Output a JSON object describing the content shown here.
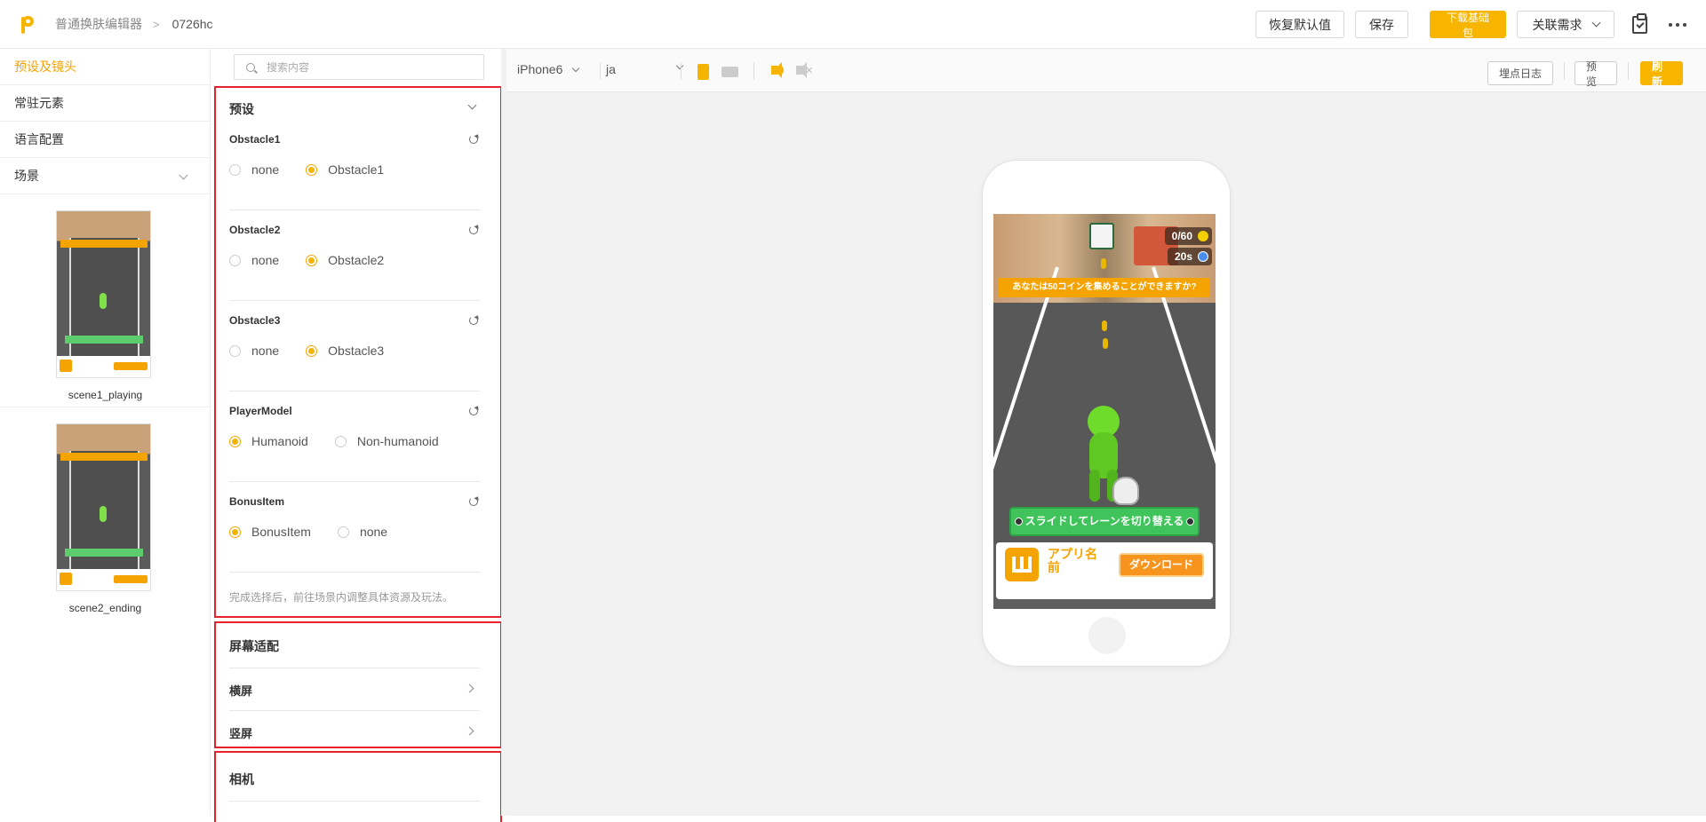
{
  "header": {
    "breadcrumb_root": "普通换肤编辑器",
    "breadcrumb_sep": ">",
    "breadcrumb_current": "0726hc",
    "reset_label": "恢复默认值",
    "save_label": "保存",
    "download_label": "下载基础包",
    "related_label": "关联需求"
  },
  "sidebar": {
    "items": [
      {
        "label": "预设及镜头"
      },
      {
        "label": "常驻元素"
      },
      {
        "label": "语言配置"
      },
      {
        "label": "场景"
      }
    ],
    "scenes": [
      {
        "label": "scene1_playing"
      },
      {
        "label": "scene2_ending"
      }
    ]
  },
  "panel": {
    "search_placeholder": "搜索内容",
    "preset_title": "预设",
    "groups": [
      {
        "title": "Obstacle1",
        "options": [
          "none",
          "Obstacle1"
        ],
        "selected": "Obstacle1"
      },
      {
        "title": "Obstacle2",
        "options": [
          "none",
          "Obstacle2"
        ],
        "selected": "Obstacle2"
      },
      {
        "title": "Obstacle3",
        "options": [
          "none",
          "Obstacle3"
        ],
        "selected": "Obstacle3"
      },
      {
        "title": "PlayerModel",
        "options": [
          "Humanoid",
          "Non-humanoid"
        ],
        "selected": "Humanoid"
      },
      {
        "title": "BonusItem",
        "options": [
          "BonusItem",
          "none"
        ],
        "selected": "BonusItem"
      }
    ],
    "note": "完成选择后，前往场景内调整具体资源及玩法。",
    "screen_title": "屏幕适配",
    "landscape_label": "横屏",
    "portrait_label": "竖屏",
    "camera_title": "相机"
  },
  "preview": {
    "device": "iPhone6",
    "language": "ja",
    "log_label": "埋点日志",
    "preview_label": "预览",
    "refresh_label": "刷新",
    "game": {
      "coins": "0/60",
      "timer": "20s",
      "quest": "あなたは50コインを集めることができますか?",
      "swipe_hint": "スライドしてレーンを切り替える",
      "app_name": "アプリ名前",
      "download": "ダウンロード"
    }
  },
  "colors": {
    "accent": "#f7b500",
    "highlight_border": "#e8222d"
  }
}
